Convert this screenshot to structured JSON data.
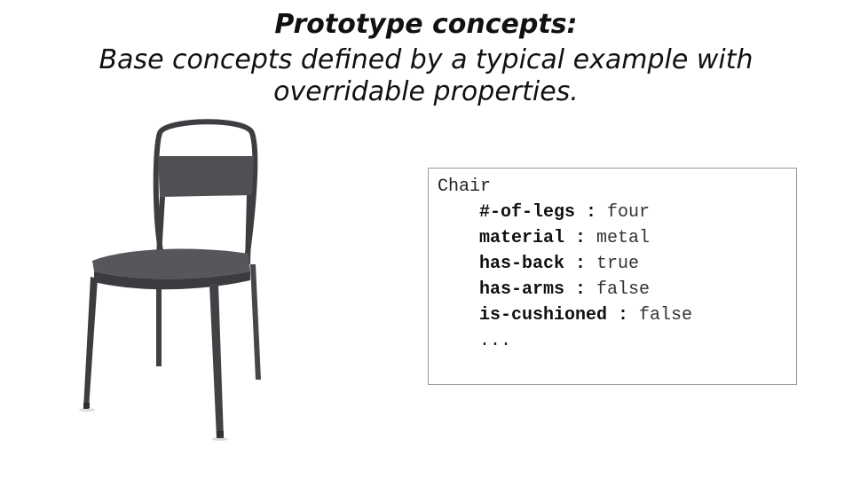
{
  "slide": {
    "title": "Prototype concepts:",
    "subtitle_line1": "Base concepts defined by a typical example with",
    "subtitle_line2": "overridable properties."
  },
  "concept": {
    "name": "Chair",
    "properties": [
      {
        "key": "#-of-legs",
        "sep": " : ",
        "value": "four"
      },
      {
        "key": "material",
        "sep": " : ",
        "value": "metal"
      },
      {
        "key": "has-back",
        "sep": " : ",
        "value": "true"
      },
      {
        "key": "has-arms",
        "sep": " : ",
        "value": "false"
      },
      {
        "key": "is-cushioned",
        "sep": " : ",
        "value": "false"
      }
    ],
    "ellipsis": "..."
  },
  "colors": {
    "chair": "#4a4c50",
    "text": "#111111",
    "box_border": "#9a9a9a"
  }
}
